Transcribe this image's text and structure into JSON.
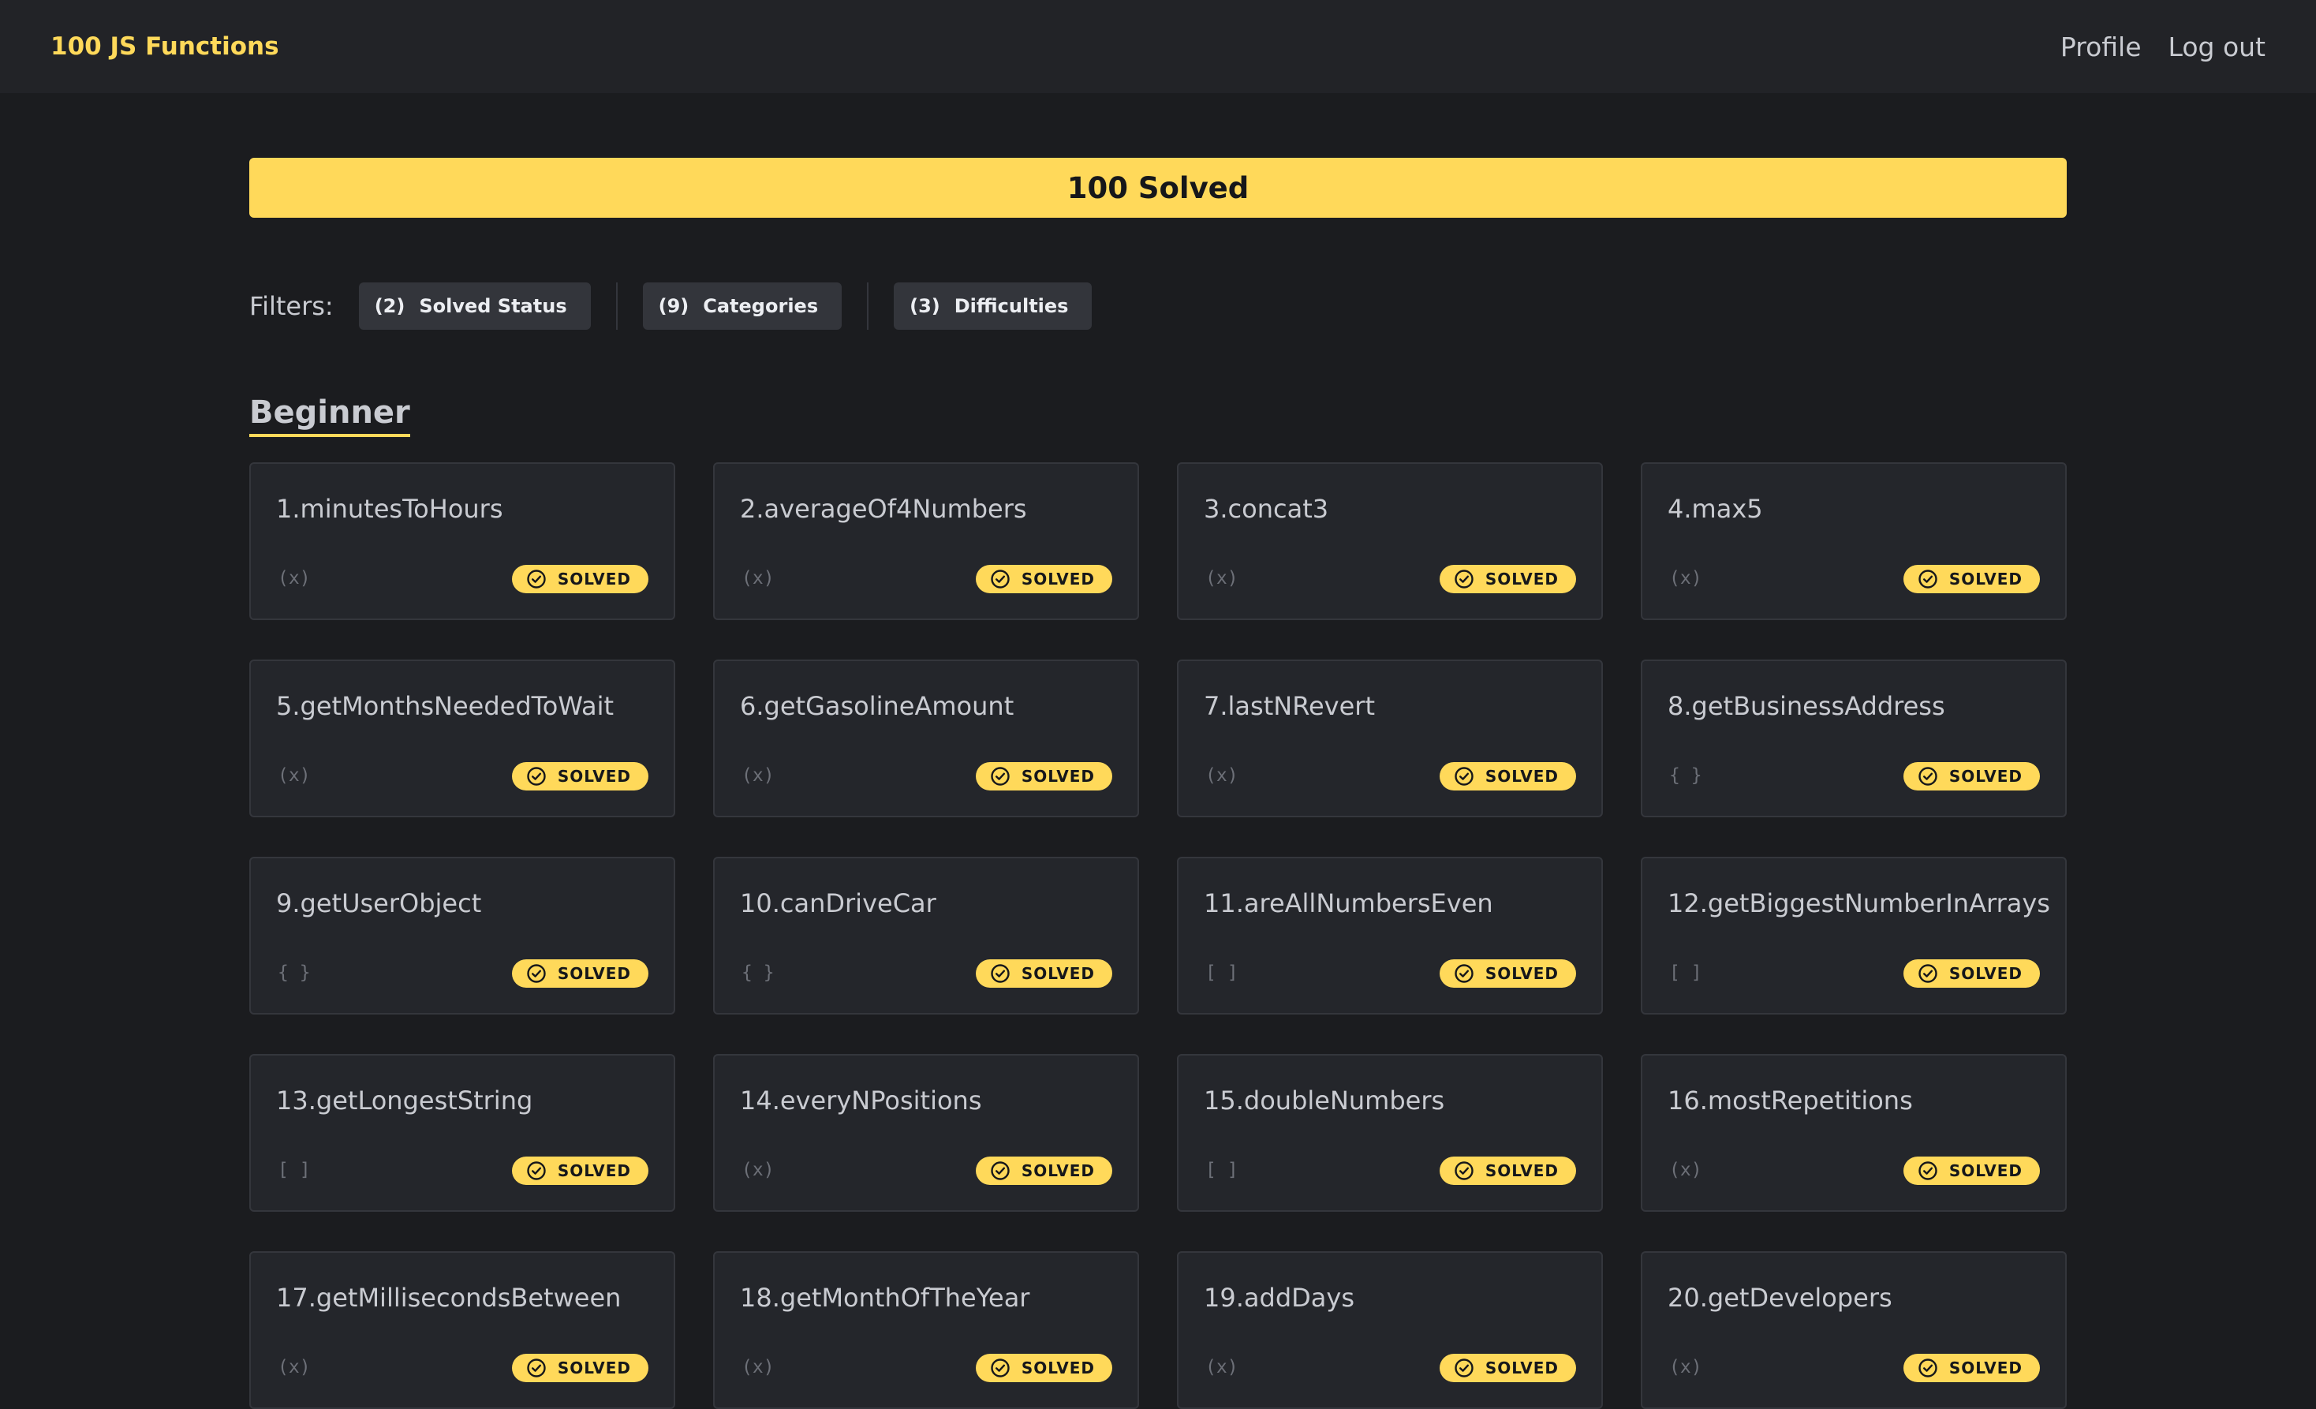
{
  "navbar": {
    "brand": "100 JS Functions",
    "links": [
      "Profile",
      "Log out"
    ]
  },
  "progress": {
    "label": "100 Solved",
    "solved": 100,
    "total": 100
  },
  "filters": {
    "label": "Filters:",
    "items": [
      {
        "count": "(2)",
        "label": "Solved Status"
      },
      {
        "count": "(9)",
        "label": "Categories"
      },
      {
        "count": "(3)",
        "label": "Difficulties"
      }
    ]
  },
  "section": {
    "title": "Beginner"
  },
  "badge_label": "SOLVED",
  "colors": {
    "accent": "#ffd95a",
    "background": "#1b1c1f",
    "navbar": "#222327",
    "card": "#24262b"
  },
  "problems": [
    {
      "title": "1.minutesToHours",
      "icon": "(x)"
    },
    {
      "title": "2.averageOf4Numbers",
      "icon": "(x)"
    },
    {
      "title": "3.concat3",
      "icon": "(x)"
    },
    {
      "title": "4.max5",
      "icon": "(x)"
    },
    {
      "title": "5.getMonthsNeededToWait",
      "icon": "(x)"
    },
    {
      "title": "6.getGasolineAmount",
      "icon": "(x)"
    },
    {
      "title": "7.lastNRevert",
      "icon": "(x)"
    },
    {
      "title": "8.getBusinessAddress",
      "icon": "{ }"
    },
    {
      "title": "9.getUserObject",
      "icon": "{ }"
    },
    {
      "title": "10.canDriveCar",
      "icon": "{ }"
    },
    {
      "title": "11.areAllNumbersEven",
      "icon": "[ ]"
    },
    {
      "title": "12.getBiggestNumberInArrays",
      "icon": "[ ]"
    },
    {
      "title": "13.getLongestString",
      "icon": "[ ]"
    },
    {
      "title": "14.everyNPositions",
      "icon": "(x)"
    },
    {
      "title": "15.doubleNumbers",
      "icon": "[ ]"
    },
    {
      "title": "16.mostRepetitions",
      "icon": "(x)"
    },
    {
      "title": "17.getMillisecondsBetween",
      "icon": "(x)"
    },
    {
      "title": "18.getMonthOfTheYear",
      "icon": "(x)"
    },
    {
      "title": "19.addDays",
      "icon": "(x)"
    },
    {
      "title": "20.getDevelopers",
      "icon": "(x)"
    }
  ]
}
